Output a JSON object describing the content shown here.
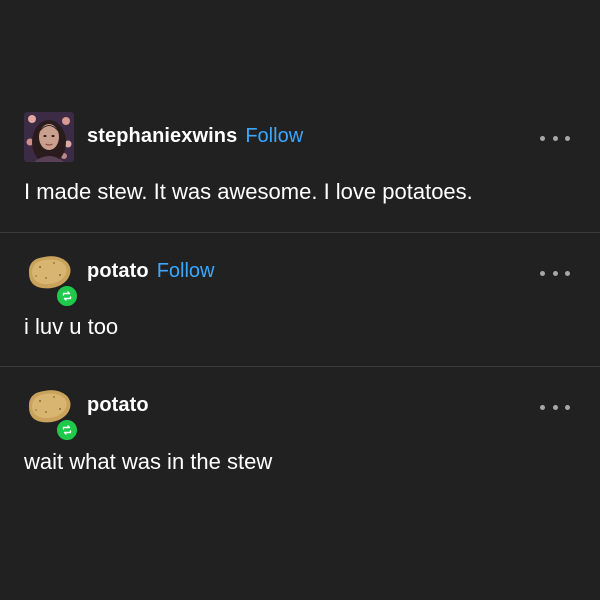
{
  "theme": {
    "background": "#212121",
    "text": "#ffffff",
    "follow_color": "#3aa7ff",
    "reblog_badge_color": "#1ec94b",
    "divider": "#3a3a3a"
  },
  "posts": [
    {
      "username": "stephaniexwins",
      "follow_label": "Follow",
      "avatar_icon": "profile-photo",
      "body": "I made stew. It was awesome. I love potatoes."
    },
    {
      "username": "potato",
      "follow_label": "Follow",
      "avatar_icon": "potato-avatar",
      "badge_icon": "reblog-icon",
      "body": "i luv u too"
    },
    {
      "username": "potato",
      "avatar_icon": "potato-avatar",
      "badge_icon": "reblog-icon",
      "body": "wait what was in the stew"
    }
  ]
}
